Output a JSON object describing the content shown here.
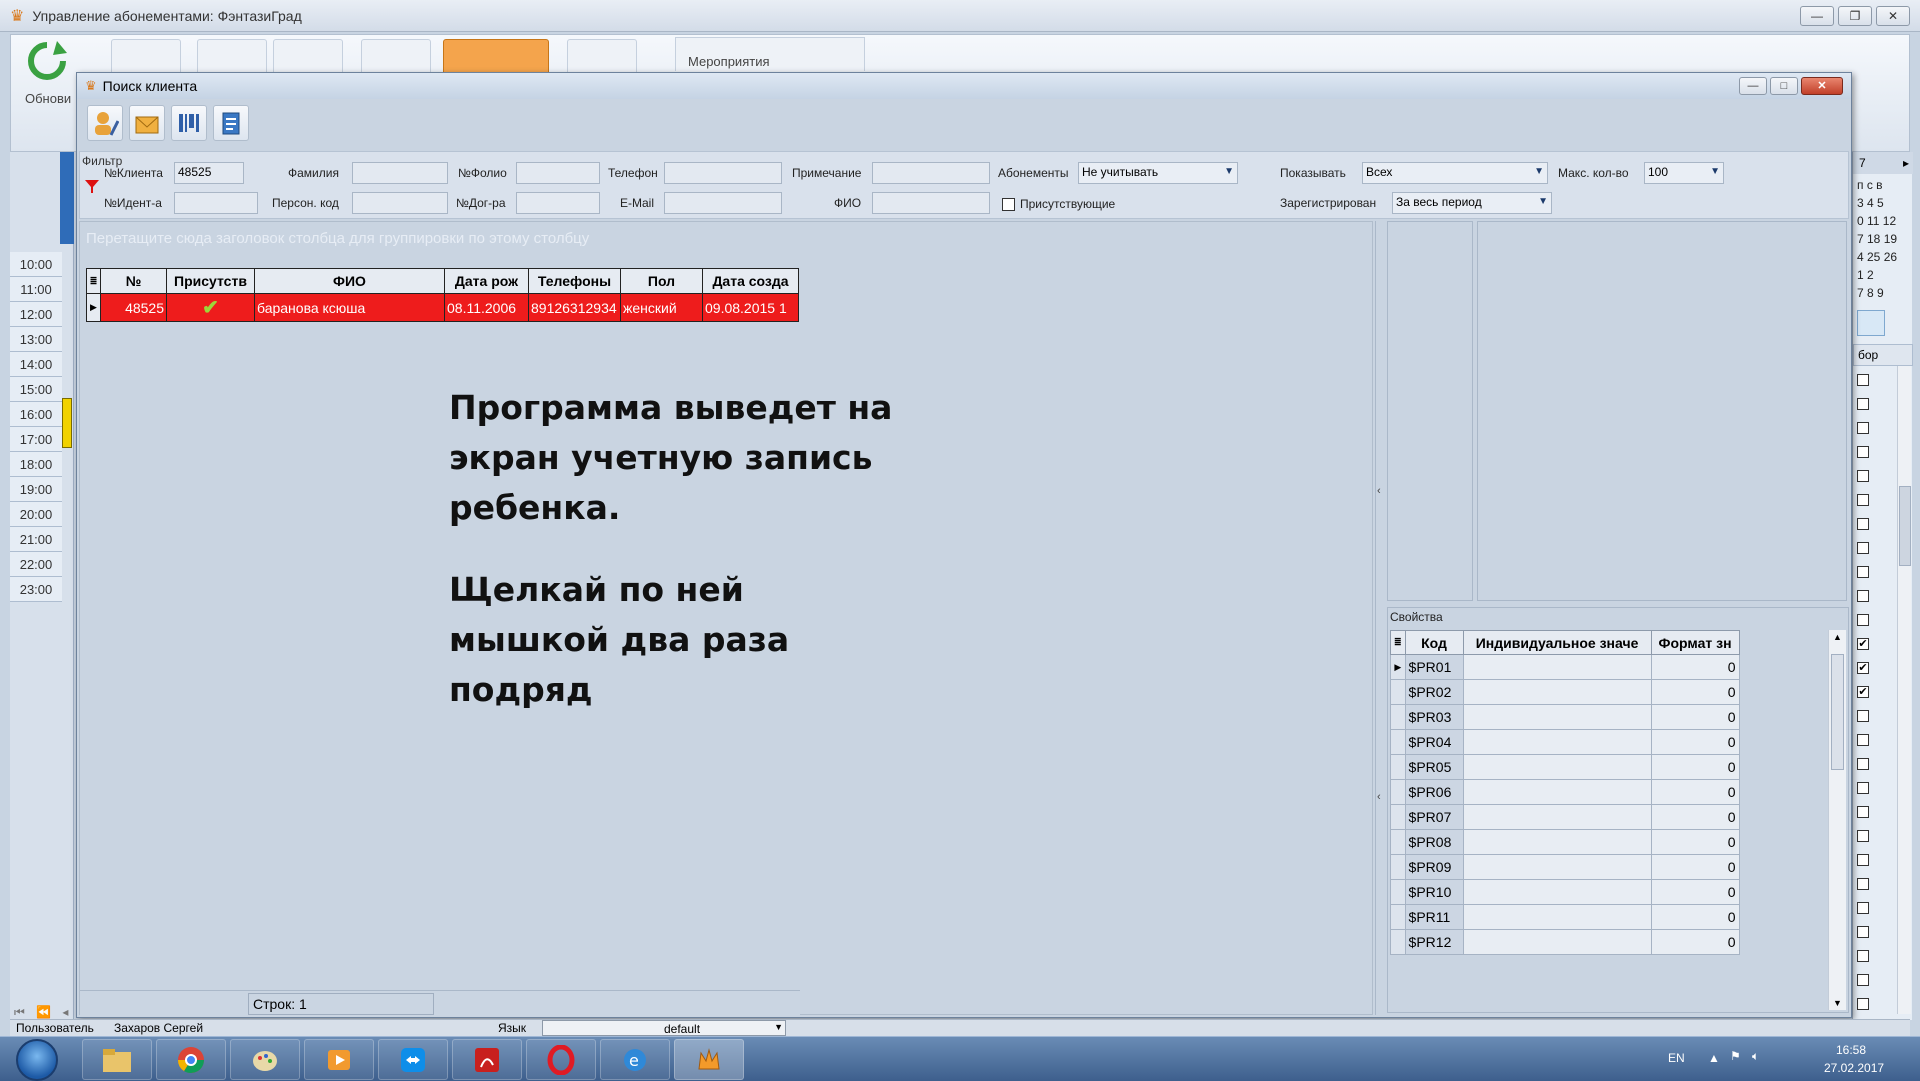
{
  "main_window": {
    "title": "Управление абонементами: ФэнтазиГрад",
    "ribbon_label_refresh": "Обнови",
    "ribbon_tab_events": "Мероприятия",
    "status_user_label": "Пользователь",
    "status_user_value": "Захаров Сергей",
    "status_lang_label": "Язык",
    "status_lang_value": "default"
  },
  "scheduler": {
    "times": [
      "10:00",
      "11:00",
      "12:00",
      "13:00",
      "14:00",
      "15:00",
      "16:00",
      "17:00",
      "18:00",
      "19:00",
      "20:00",
      "21:00",
      "22:00",
      "23:00"
    ]
  },
  "calendar_strip": {
    "header": "7",
    "rows": [
      "п  с  в",
      "3  4  5",
      "0 11 12",
      "7 18 19",
      "4 25 26",
      "1  2",
      "7  8  9"
    ],
    "select_header": "бор",
    "checked_rows": [
      11,
      12,
      13
    ]
  },
  "dialog": {
    "title": "Поиск клиента",
    "filter": {
      "caption": "Фильтр",
      "client_no_label": "№Клиента",
      "client_no_value": "48525",
      "surname_label": "Фамилия",
      "folio_label": "№Фолио",
      "phone_label": "Телефон",
      "note_label": "Примечание",
      "subscriptions_label": "Абонементы",
      "subscriptions_value": "Не учитывать",
      "show_label": "Показывать",
      "show_value": "Всех",
      "max_label": "Макс. кол-во",
      "max_value": "100",
      "ident_label": "№Идент-а",
      "personal_code_label": "Персон. код",
      "contract_label": "№Дог-ра",
      "email_label": "E-Mail",
      "fio_label": "ФИО",
      "present_label": "Присутствующие",
      "registered_label": "Зарегистрирован",
      "registered_value": "За весь период"
    },
    "grid": {
      "group_hint": "Перетащите сюда заголовок столбца для группировки по этому столбцу",
      "columns": [
        "№",
        "Присутств",
        "ФИО",
        "Дата рож",
        "Телефоны",
        "Пол",
        "Дата созда"
      ],
      "rows": [
        {
          "no": "48525",
          "present": "✔",
          "fio": "баранова ксюша",
          "birth": "08.11.2006",
          "phones": "89126312934",
          "sex": "женский",
          "created": "09.08.2015 1"
        }
      ],
      "rows_count_text": "Строк: 1"
    },
    "instruction": {
      "line1": "Программа выведет на",
      "line2": "экран учетную запись",
      "line3": "ребенка.",
      "line4": "Щелкай по ней",
      "line5": "мышкой два раза",
      "line6": "подряд"
    },
    "properties": {
      "caption": "Свойства",
      "columns": [
        "Код",
        "Индивидуальное значе",
        "Формат зн"
      ],
      "rows": [
        {
          "code": "$PR01",
          "value": "",
          "format": "0"
        },
        {
          "code": "$PR02",
          "value": "",
          "format": "0"
        },
        {
          "code": "$PR03",
          "value": "",
          "format": "0"
        },
        {
          "code": "$PR04",
          "value": "",
          "format": "0"
        },
        {
          "code": "$PR05",
          "value": "",
          "format": "0"
        },
        {
          "code": "$PR06",
          "value": "",
          "format": "0"
        },
        {
          "code": "$PR07",
          "value": "",
          "format": "0"
        },
        {
          "code": "$PR08",
          "value": "",
          "format": "0"
        },
        {
          "code": "$PR09",
          "value": "",
          "format": "0"
        },
        {
          "code": "$PR10",
          "value": "",
          "format": "0"
        },
        {
          "code": "$PR11",
          "value": "",
          "format": "0"
        },
        {
          "code": "$PR12",
          "value": "",
          "format": "0"
        }
      ]
    }
  },
  "taskbar": {
    "lang": "EN",
    "time": "16:58",
    "date": "27.02.2017"
  },
  "colors": {
    "selected_row": "#ee1c1c",
    "dialog_bg": "#c9d4e1",
    "accent": "#f4a44c"
  }
}
